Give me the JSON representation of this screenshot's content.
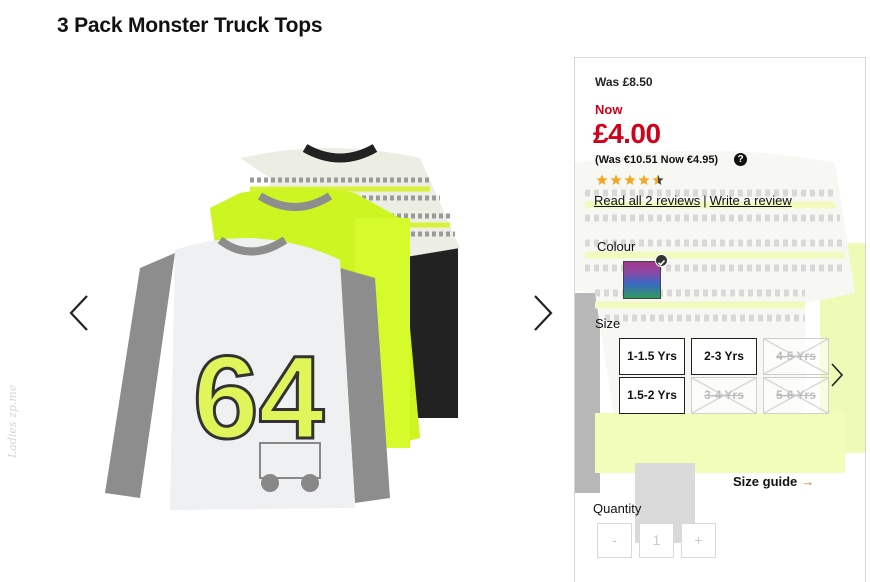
{
  "product": {
    "title": "3 Pack Monster Truck Tops"
  },
  "gallery": {
    "prev_icon": "chevron-left-icon",
    "next_icon": "chevron-right-icon"
  },
  "pricing": {
    "was": "Was £8.50",
    "now_label": "Now",
    "now_price": "£4.00",
    "euro": "(Was €10.51 Now €4.95)",
    "help_icon": "?",
    "accent_color": "#d0021b"
  },
  "rating": {
    "stars": 4.5,
    "max": 5,
    "star_color": "#f5a623",
    "read_reviews": "Read all 2 reviews",
    "separator": "|",
    "write_review": "Write a review"
  },
  "colour": {
    "label": "Colour",
    "swatch_icon": "multicolour-swatch",
    "selected": true
  },
  "size": {
    "label": "Size",
    "options": [
      {
        "label": "1-1.5 Yrs",
        "available": true
      },
      {
        "label": "2-3 Yrs",
        "available": true
      },
      {
        "label": "4-5 Yrs",
        "available": false
      },
      {
        "label": "1.5-2 Yrs",
        "available": true
      },
      {
        "label": "3-4 Yrs",
        "available": false
      },
      {
        "label": "5-6 Yrs",
        "available": false
      }
    ],
    "guide": "Size guide",
    "guide_arrow": "→"
  },
  "quantity": {
    "label": "Quantity",
    "minus": "-",
    "value": "1",
    "plus": "+"
  },
  "watermark": "Ladies zp.me"
}
